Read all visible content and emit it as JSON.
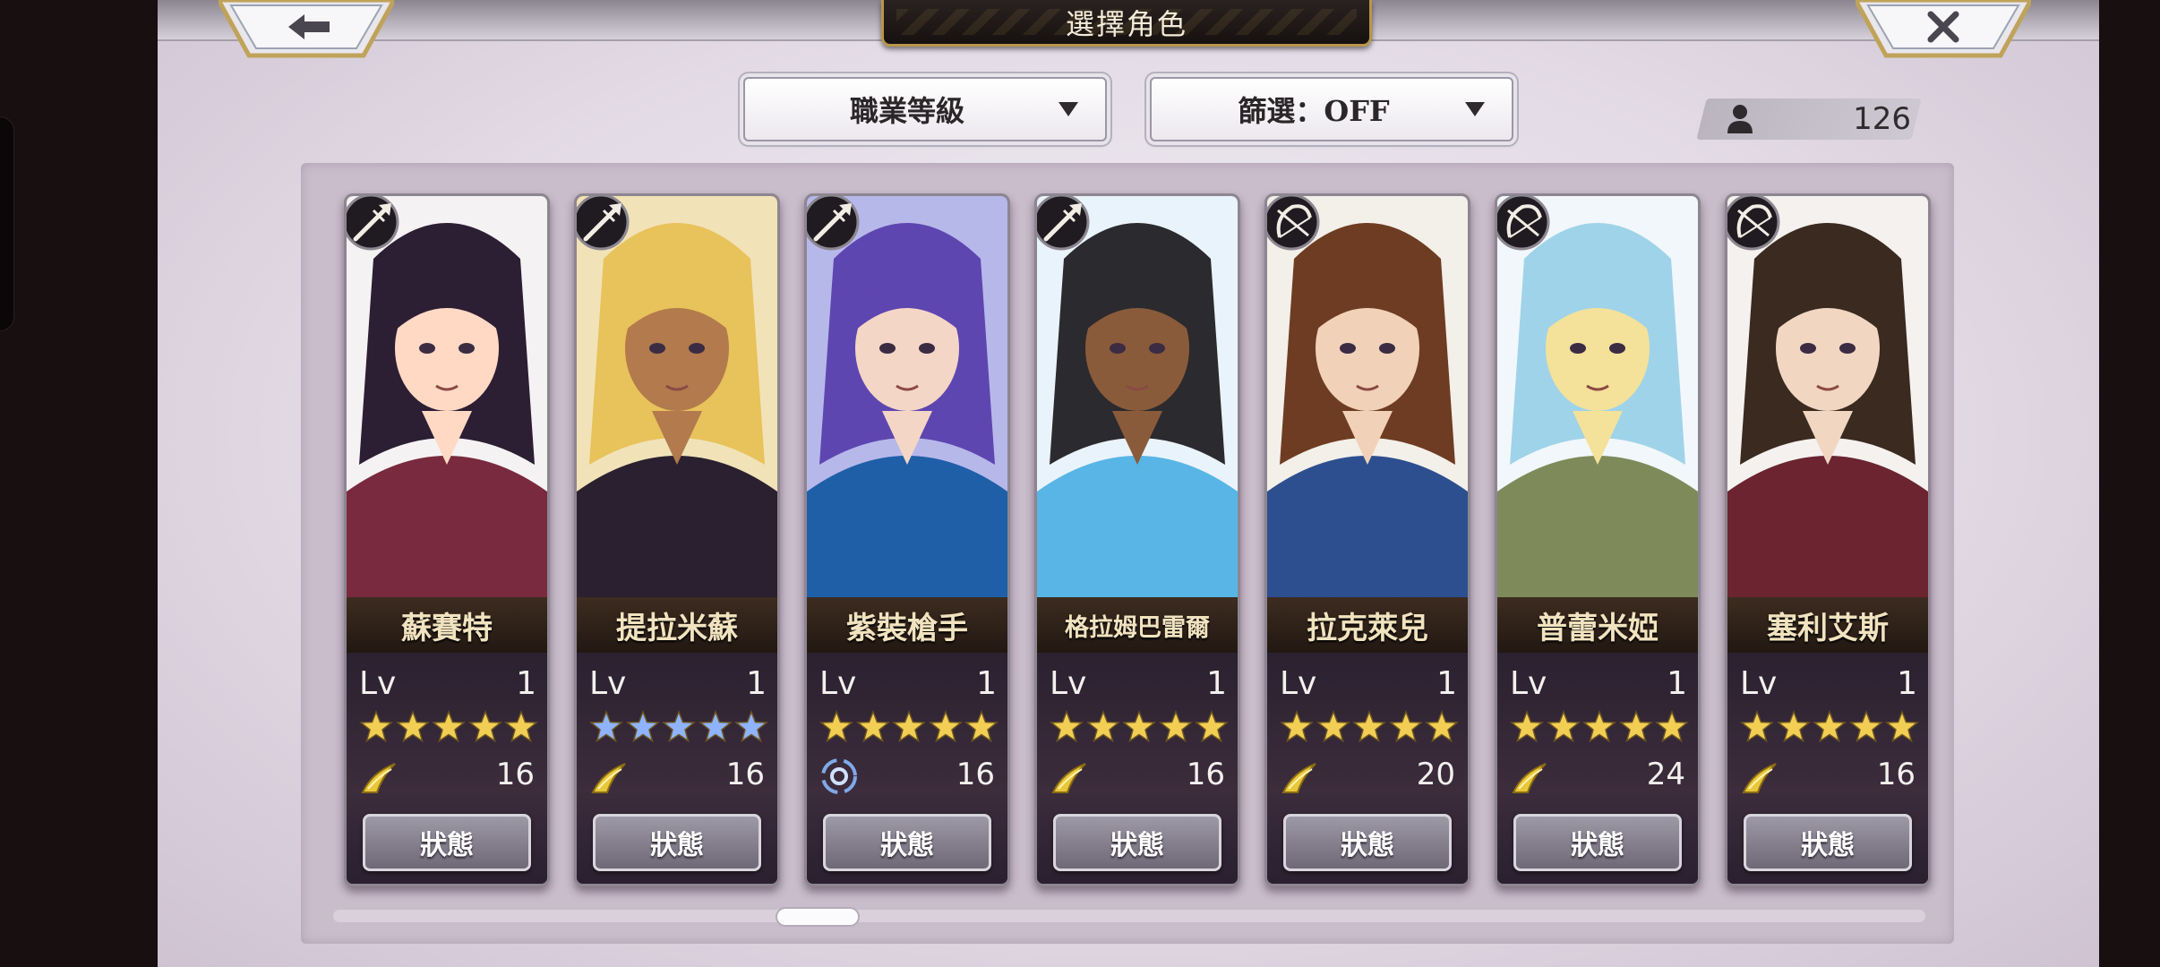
{
  "header": {
    "title": "選擇角色",
    "back_icon": "arrow-left-icon",
    "close_icon": "close-x-icon"
  },
  "toolbar": {
    "sort_dropdown": {
      "label": "職業等級"
    },
    "filter_dropdown": {
      "label": "篩選：OFF"
    },
    "character_count": "126"
  },
  "colors": {
    "title_plate": "#1f1816",
    "title_trim": "#b9954a",
    "panel": "#e6e0e9",
    "star_gold": "#f2cf54",
    "star_blue": "#8fb3ff"
  },
  "characters": [
    {
      "name": "蘇賽特",
      "lv_label": "Lv",
      "lv": "1",
      "stars": 5,
      "star_color": "gold",
      "weapon": "spear-icon",
      "element": "wind-icon",
      "cost": "16",
      "status_label": "狀態",
      "palette": [
        "#f5f2f4",
        "#2c1e33",
        "#ffd9c4",
        "#7a2a3e"
      ]
    },
    {
      "name": "提拉米蘇",
      "lv_label": "Lv",
      "lv": "1",
      "stars": 5,
      "star_color": "blue",
      "weapon": "spear-icon",
      "element": "wind-icon",
      "cost": "16",
      "status_label": "狀態",
      "palette": [
        "#f1e2b8",
        "#e8c25a",
        "#b27a4d",
        "#2a2030"
      ]
    },
    {
      "name": "紫裝槍手",
      "lv_label": "Lv",
      "lv": "1",
      "stars": 5,
      "star_color": "gold",
      "weapon": "spear-icon",
      "element": "water-swirl-icon",
      "cost": "16",
      "status_label": "狀態",
      "palette": [
        "#b7b8ea",
        "#5e46b0",
        "#f4d6c6",
        "#1f5fa8"
      ]
    },
    {
      "name": "格拉姆巴雷爾",
      "lv_label": "Lv",
      "lv": "1",
      "stars": 5,
      "star_color": "gold",
      "weapon": "spear-icon",
      "element": "wind-icon",
      "cost": "16",
      "status_label": "狀態",
      "palette": [
        "#e9f3fb",
        "#2b2a2e",
        "#8a5b3a",
        "#58b5e6"
      ]
    },
    {
      "name": "拉克萊兒",
      "lv_label": "Lv",
      "lv": "1",
      "stars": 5,
      "star_color": "gold",
      "weapon": "bow-icon",
      "element": "wind-icon",
      "cost": "20",
      "status_label": "狀態",
      "palette": [
        "#f3efe9",
        "#6e3c22",
        "#f1d1b8",
        "#2d4f8f"
      ]
    },
    {
      "name": "普蕾米婭",
      "lv_label": "Lv",
      "lv": "1",
      "stars": 5,
      "star_color": "gold",
      "weapon": "bow-icon",
      "element": "wind-icon",
      "cost": "24",
      "status_label": "狀態",
      "palette": [
        "#f2f7fb",
        "#9fd3e9",
        "#f4e19a",
        "#7f8a5a"
      ]
    },
    {
      "name": "塞利艾斯",
      "lv_label": "Lv",
      "lv": "1",
      "stars": 5,
      "star_color": "gold",
      "weapon": "bow-icon",
      "element": "wind-icon",
      "cost": "16",
      "status_label": "狀態",
      "palette": [
        "#f4f1ef",
        "#3a2a1f",
        "#f1d6c2",
        "#6b2430"
      ]
    }
  ],
  "scroll": {
    "position": 0.3
  }
}
